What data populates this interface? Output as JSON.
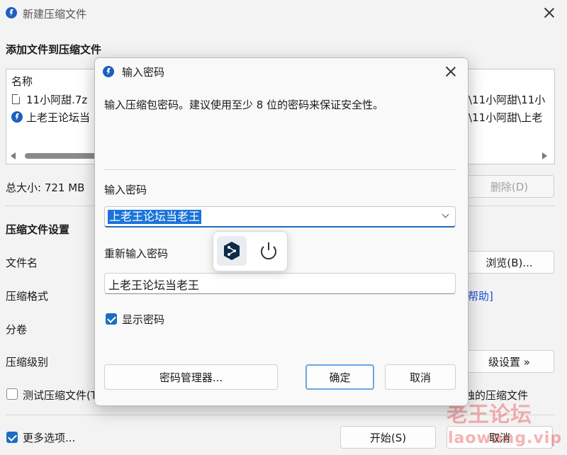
{
  "main_window": {
    "title": "新建压缩文件",
    "section_add": "添加文件到压缩文件",
    "list_header": "名称",
    "files": [
      {
        "name": "11小阿甜.7z",
        "path": "\\11小阿甜\\11小"
      },
      {
        "name": "上老王论坛当",
        "path": "\\11小阿甜\\上老"
      }
    ],
    "total_size": "总大小: 721 MB",
    "delete_button": "删除(D)",
    "section_settings": "压缩文件设置",
    "label_filename": "文件名",
    "browse_button": "浏览(B)...",
    "label_format": "压缩格式",
    "help_link": "帮助]",
    "label_split": "分卷",
    "label_level": "压缩级别",
    "advanced_button": "级设置 »",
    "test_checkbox": "测试压缩文件(T)",
    "solid_checkbox": "蚀的压缩文件",
    "more_options": "更多选项...",
    "start_button": "开始(S)",
    "cancel_button": "取消"
  },
  "dialog": {
    "title": "输入密码",
    "description": "输入压缩包密码。建议使用至少 8 位的密码来保证安全性。",
    "label_password": "输入密码",
    "password_value": "上老王论坛当老王",
    "label_reenter": "重新输入密码",
    "reenter_value": "上老王论坛当老王",
    "show_password": "显示密码",
    "manager_button": "密码管理器...",
    "ok_button": "确定",
    "cancel_button": "取消"
  },
  "watermark": {
    "line1": "老王论坛",
    "line2": "laowang.vip"
  },
  "icons": {
    "app": "app-logo-icon",
    "close": "close-icon",
    "deepl": "deepl-icon",
    "power": "power-icon"
  },
  "colors": {
    "accent": "#1b6ec2",
    "selection": "#1a73d9",
    "window_bg": "#f3f3f3"
  }
}
